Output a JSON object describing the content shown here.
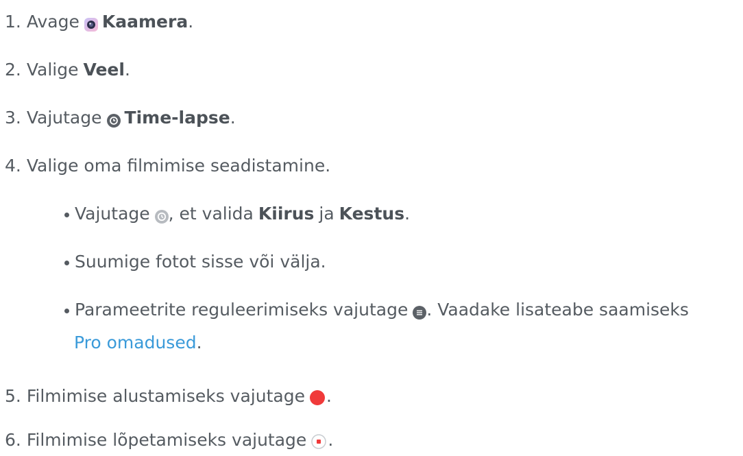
{
  "steps": [
    {
      "num": "1.",
      "pre": "Avage",
      "icon": "camera-app-icon",
      "bold": "Kaamera",
      "post": "."
    },
    {
      "num": "2.",
      "pre": "Valige",
      "bold": "Veel",
      "post": "."
    },
    {
      "num": "3.",
      "pre": "Vajutage",
      "icon": "time-lapse-icon",
      "bold": "Time-lapse",
      "post": "."
    },
    {
      "num": "4.",
      "text": "Valige oma filmimise seadistamine."
    },
    {
      "num": "5.",
      "pre": "Filmimise alustamiseks vajutage",
      "icon": "record-button-icon",
      "post": "."
    },
    {
      "num": "6.",
      "pre": "Filmimise lõpetamiseks vajutage",
      "icon": "stop-record-icon",
      "post": "."
    }
  ],
  "substeps": {
    "a": {
      "pre": "Vajutage",
      "icon": "timer-settings-icon",
      "mid1": ", et valida",
      "bold1": "Kiirus",
      "mid2": "ja",
      "bold2": "Kestus",
      "post": "."
    },
    "b": {
      "text": "Suumige fotot sisse või välja."
    },
    "c": {
      "pre": "Parameetrite reguleerimiseks vajutage",
      "icon": "parameters-menu-icon",
      "post": ". Vaadake lisateabe saamiseks",
      "link": "Pro omadused",
      "link_post": "."
    }
  },
  "colors": {
    "text": "#555b61",
    "link": "#3a9ad9",
    "record_red": "#f03a3a"
  }
}
